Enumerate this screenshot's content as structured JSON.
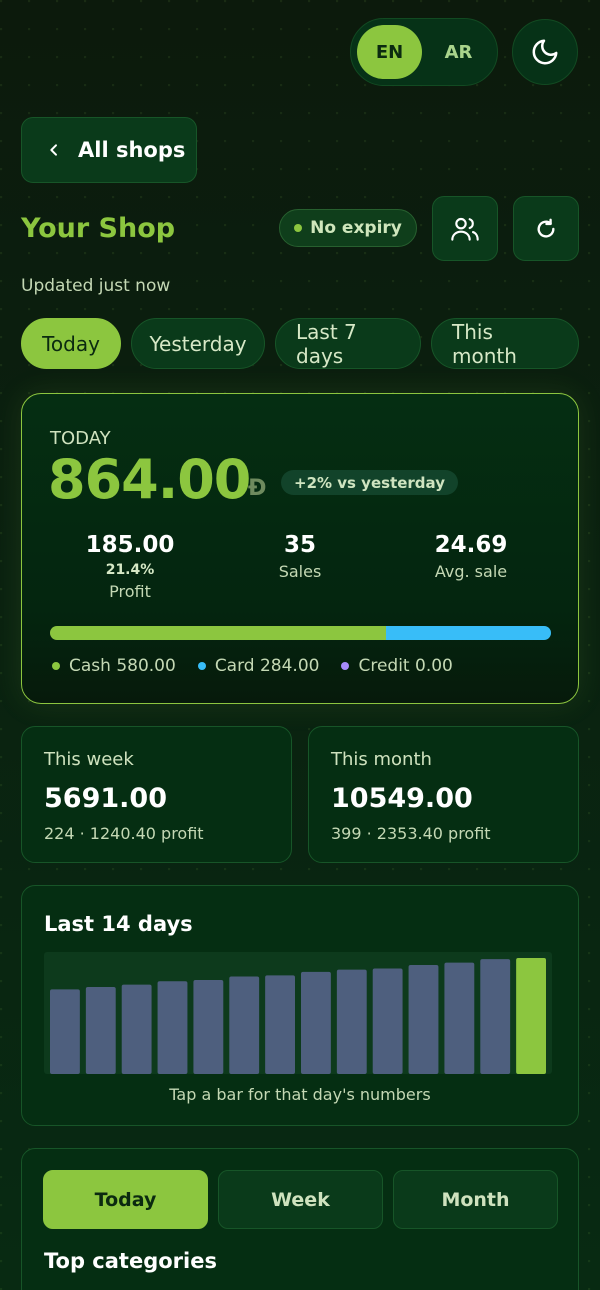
{
  "language": {
    "options": [
      "EN",
      "AR"
    ],
    "active": "EN"
  },
  "icons": {
    "theme": "moon-icon",
    "back": "chevron-left-icon",
    "users": "users-icon",
    "refresh": "refresh-icon"
  },
  "nav": {
    "back_label": "All shops"
  },
  "shop": {
    "title": "Your Shop",
    "expiry_badge": "No expiry",
    "updated": "Updated just now"
  },
  "ranges": [
    "Today",
    "Yesterday",
    "Last 7 days",
    "This month"
  ],
  "active_range": "Today",
  "today_card": {
    "label": "TODAY",
    "amount": "864.00",
    "currency_symbol": "Đ",
    "delta": "+2% vs yesterday",
    "stats": [
      {
        "value": "185.00",
        "sub": "21.4%",
        "label": "Profit"
      },
      {
        "value": "35",
        "sub": "",
        "label": "Sales"
      },
      {
        "value": "24.69",
        "sub": "",
        "label": "Avg. sale"
      }
    ],
    "split": {
      "cash": 580.0,
      "card": 284.0,
      "credit": 0.0
    },
    "legend": [
      "Cash 580.00",
      "Card 284.00",
      "Credit 0.00"
    ]
  },
  "week_card": {
    "title": "This week",
    "value": "5691.00",
    "detail": "224 · 1240.40 profit"
  },
  "month_card": {
    "title": "This month",
    "value": "10549.00",
    "detail": "399 · 2353.40 profit"
  },
  "chart_data": {
    "type": "bar",
    "title": "Last 14 days",
    "hint": "Tap a bar for that day's numbers",
    "values": [
      73,
      75,
      77,
      80,
      81,
      84,
      85,
      88,
      90,
      91,
      94,
      96,
      99,
      100
    ],
    "ylim": [
      0,
      100
    ],
    "highlight_last": true,
    "colors": {
      "bar": "#4e5f7e",
      "highlight": "#8cc63f",
      "track": "#0d3a1c"
    }
  },
  "bottom": {
    "periods": [
      "Today",
      "Week",
      "Month"
    ],
    "active_period": "Today",
    "section_title": "Top categories"
  },
  "colors": {
    "accent": "#8cc63f",
    "card": "#38bdf8",
    "credit": "#a78bfa"
  }
}
